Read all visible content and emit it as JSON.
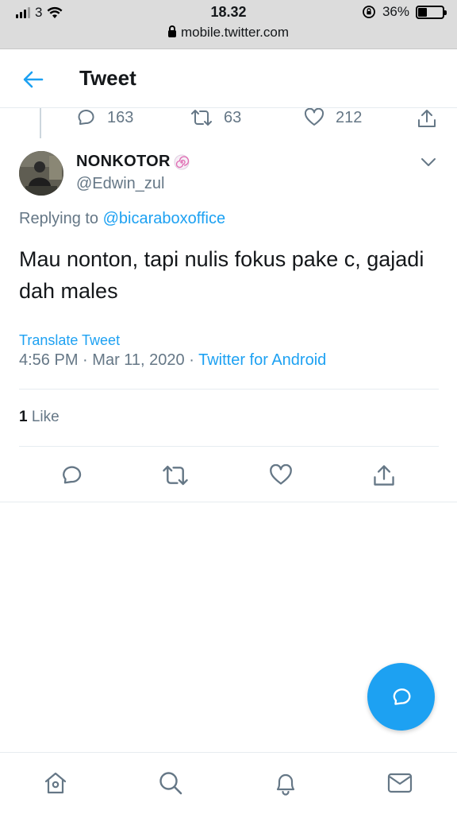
{
  "status_bar": {
    "carrier": "3",
    "time": "18.32",
    "battery_percent": "36%",
    "battery_level": 0.36
  },
  "browser": {
    "url": "mobile.twitter.com"
  },
  "header": {
    "title": "Tweet",
    "back_icon": "arrow-left-icon"
  },
  "previous_tweet_actions": {
    "replies": "163",
    "retweets": "63",
    "likes": "212"
  },
  "tweet": {
    "display_name": "NONKOTOR",
    "name_emoji": "🍥",
    "handle": "@Edwin_zul",
    "replying_prefix": "Replying to",
    "replying_to": "@bicaraboxoffice",
    "text": "Mau nonton, tapi nulis fokus pake c, gajadi dah males",
    "translate_label": "Translate Tweet",
    "time": "4:56 PM",
    "date": "Mar 11, 2020",
    "separator": "·",
    "client": "Twitter for Android",
    "like_count": "1",
    "like_label": "Like"
  },
  "icons": {
    "reply": "reply-icon",
    "retweet": "retweet-icon",
    "like": "heart-icon",
    "share": "share-icon",
    "caret": "chevron-down-icon",
    "fab": "compose-icon",
    "nav": [
      "home-icon",
      "search-icon",
      "bell-icon",
      "mail-icon"
    ]
  },
  "colors": {
    "accent": "#1da1f2",
    "muted": "#657786",
    "text": "#14171a"
  }
}
